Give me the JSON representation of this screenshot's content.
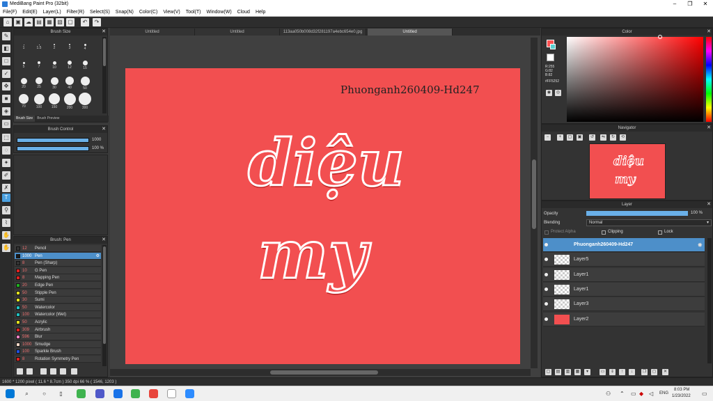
{
  "window": {
    "title": "MediBang Paint Pro (32bit)",
    "min": "–",
    "max": "❐",
    "close": "✕"
  },
  "menu": [
    "File(F)",
    "Edit(E)",
    "Layer(L)",
    "Filter(R)",
    "Select(S)",
    "Snap(N)",
    "Color(C)",
    "View(V)",
    "Tool(T)",
    "Window(W)",
    "Cloud",
    "Help"
  ],
  "panels": {
    "brush_size": {
      "title": "Brush Size",
      "sizes": [
        "1",
        "1.5",
        "2",
        "3",
        "4",
        "5",
        "7",
        "10",
        "12",
        "15",
        "20",
        "25",
        "30",
        "40",
        "50",
        "70",
        "100",
        "150",
        "200",
        "300"
      ],
      "tab_size": "Brush Size",
      "tab_preview": "Brush Preview"
    },
    "brush_control": {
      "title": "Brush Control",
      "size_value": "1000",
      "opacity_value": "100 %",
      "size_fraction": 1.0,
      "opacity_fraction": 1.0
    },
    "brush_list": {
      "title": "Brush: Pen",
      "items": [
        {
          "size": "12",
          "name": "Pencil",
          "color": "#333333"
        },
        {
          "size": "1000",
          "name": "Pen",
          "color": "#1a1a1a"
        },
        {
          "size": "8",
          "name": "Pen (Sharp)",
          "color": "#333333"
        },
        {
          "size": "10",
          "name": "G Pen",
          "color": "#e02020"
        },
        {
          "size": "8",
          "name": "Mapping Pen",
          "color": "#e02020"
        },
        {
          "size": "20",
          "name": "Edge Pen",
          "color": "#20b020"
        },
        {
          "size": "50",
          "name": "Stipple Pen",
          "color": "#e0e020"
        },
        {
          "size": "30",
          "name": "Sumi",
          "color": "#e0e020"
        },
        {
          "size": "50",
          "name": "Watercolor",
          "color": "#20c0c0"
        },
        {
          "size": "100",
          "name": "Watercolor (Wet)",
          "color": "#20c0c0"
        },
        {
          "size": "50",
          "name": "Acrylic",
          "color": "#e0e020"
        },
        {
          "size": "309",
          "name": "Airbrush",
          "color": "#e02020"
        },
        {
          "size": "596",
          "name": "Blur",
          "color": "#f080c0"
        },
        {
          "size": "1000",
          "name": "Smudge",
          "color": "#f5d8c8"
        },
        {
          "size": "100",
          "name": "Sparkle Brush",
          "color": "#2050e0"
        },
        {
          "size": "8",
          "name": "Rotation Symmetry Pen",
          "color": "#e02020"
        }
      ]
    },
    "color": {
      "title": "Color",
      "r": "R:255",
      "g": "G:82",
      "b": "B:82",
      "hex": "#FF5252",
      "main": "#ff5252"
    },
    "navigator": {
      "title": "Navigator"
    },
    "layer": {
      "title": "Layer",
      "opacity_label": "Opacity",
      "opacity_value": "100 %",
      "opacity_fraction": 1.0,
      "blending_label": "Blending",
      "blending_value": "Normal",
      "protect_alpha": "Protect Alpha",
      "clipping": "Clipping",
      "lock": "Lock",
      "layers": [
        {
          "name": "Phuonganh260409-Hd247",
          "selected": true
        },
        {
          "name": "Layer5",
          "selected": false
        },
        {
          "name": "Layer1",
          "selected": false
        },
        {
          "name": "Layer1",
          "selected": false
        },
        {
          "name": "Layer3",
          "selected": false
        },
        {
          "name": "Layer2",
          "selected": false
        }
      ]
    }
  },
  "tabs": [
    "Untitled",
    "Untitled",
    "113aa050b008d32f281197a4ebc654e0.jpg",
    "Untitled"
  ],
  "canvas": {
    "watermark": "Phuonganh260409-Hd247",
    "line1": "diệu",
    "line2": "my",
    "bg": "#f24f50"
  },
  "status": {
    "text": "1600 * 1200 pixel   ( 11.6 * 8.7cm )   350 dpi   66 %   ( 1546, 1203 )"
  },
  "taskbar": {
    "time": "8:03 PM",
    "date": "1/23/2022",
    "lang": "ENG"
  }
}
